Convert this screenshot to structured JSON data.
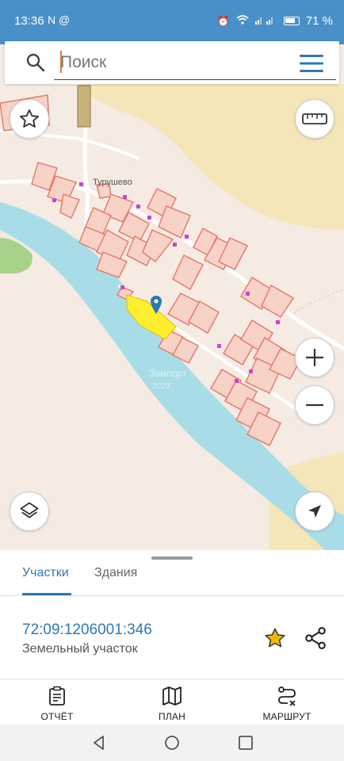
{
  "status": {
    "time": "13:36",
    "left_icons": "N @",
    "battery": "71 %"
  },
  "search": {
    "placeholder": "Поиск"
  },
  "map": {
    "village": "Турушево",
    "watermark_1": "Зампорт",
    "watermark_2": "2023"
  },
  "sheet": {
    "tabs": [
      "Участки",
      "Здания"
    ],
    "cadastral_number": "72:09:1206001:346",
    "type": "Земельный участок"
  },
  "nav": {
    "report": "ОТЧЁТ",
    "plan": "ПЛАН",
    "route": "МАРШРУТ"
  },
  "colors": {
    "accent": "#2f78b4",
    "river": "#a8dde8",
    "parcel_stroke": "#e5766a",
    "highlight": "#ffee2e",
    "star": "#f2b705"
  },
  "icons": [
    "search-icon",
    "menu-icon",
    "star-outline-icon",
    "ruler-icon",
    "zoom-in-icon",
    "zoom-out-icon",
    "layers-icon",
    "navigation-arrow-icon",
    "star-filled-icon",
    "share-icon",
    "clipboard-icon",
    "map-icon",
    "route-icon",
    "back-icon",
    "home-icon",
    "recents-icon",
    "location-pin-icon"
  ]
}
